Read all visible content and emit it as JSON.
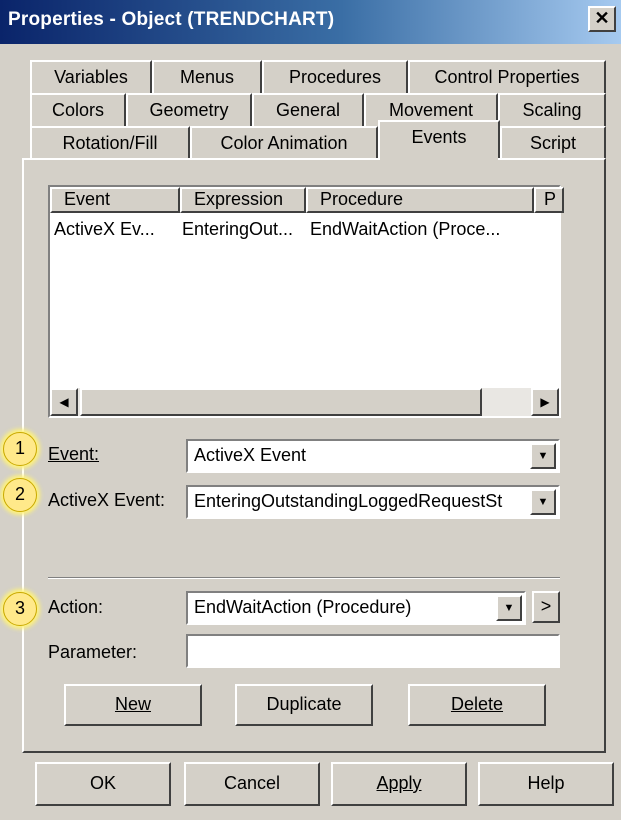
{
  "window": {
    "title": "Properties - Object (TRENDCHART)",
    "close_glyph": "✕"
  },
  "tabs": {
    "row1": [
      "Variables",
      "Menus",
      "Procedures",
      "Control Properties"
    ],
    "row2": [
      "Colors",
      "Geometry",
      "General",
      "Movement",
      "Scaling"
    ],
    "row3": [
      "Rotation/Fill",
      "Color Animation",
      "Events",
      "Script"
    ],
    "active": "Events"
  },
  "events_list": {
    "columns": [
      "Event",
      "Expression",
      "Procedure",
      "P"
    ],
    "rows": [
      {
        "event": "ActiveX Ev...",
        "expression": "EnteringOut...",
        "procedure": "EndWaitAction (Proce..."
      }
    ]
  },
  "form": {
    "event_label": "Event:",
    "event_value": "ActiveX Event",
    "activex_label": "ActiveX Event:",
    "activex_value": "EnteringOutstandingLoggedRequestSt",
    "action_label": "Action:",
    "action_value": "EndWaitAction (Procedure)",
    "action_more": ">",
    "parameter_label": "Parameter:",
    "parameter_value": ""
  },
  "callouts": [
    "1",
    "2",
    "3"
  ],
  "action_buttons": {
    "new": "New",
    "duplicate": "Duplicate",
    "delete": "Delete"
  },
  "dialog_buttons": {
    "ok": "OK",
    "cancel": "Cancel",
    "apply": "Apply",
    "help": "Help"
  },
  "colors": {
    "title_start": "#0a246a",
    "title_end": "#a6caf0",
    "face": "#d4d0c8",
    "callout": "#ffe98a"
  }
}
